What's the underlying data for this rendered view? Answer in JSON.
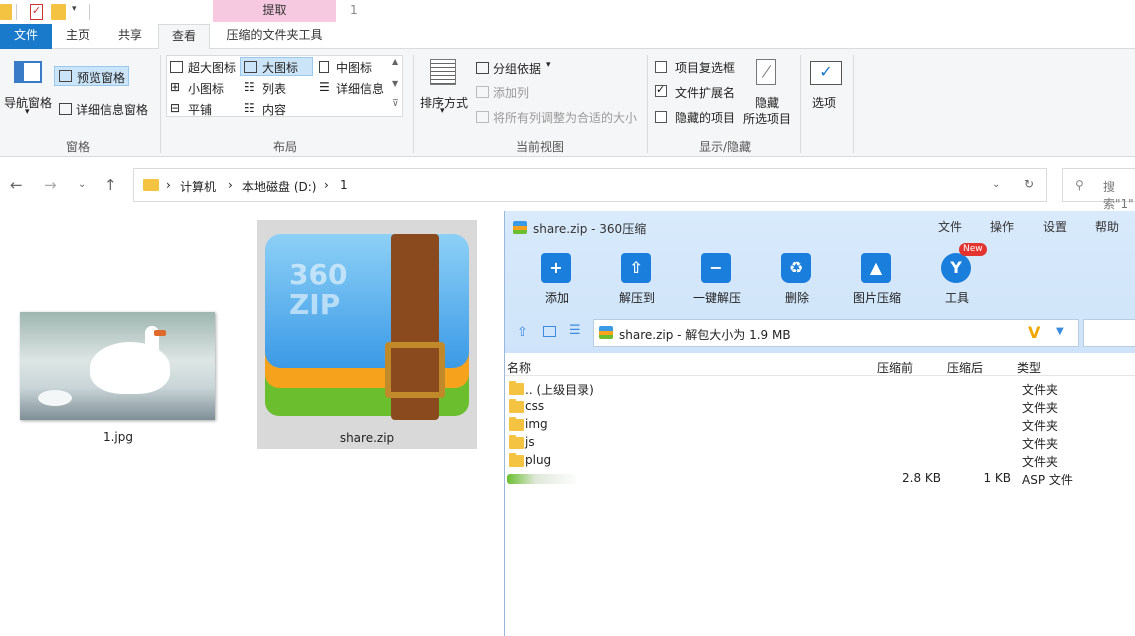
{
  "titlebar": {
    "context_header": "提取",
    "title": "1"
  },
  "ribbon_tabs": {
    "file": "文件",
    "home": "主页",
    "share": "共享",
    "view": "查看",
    "zip_tools": "压缩的文件夹工具"
  },
  "ribbon": {
    "panes": {
      "nav_pane": "导航窗格",
      "preview_pane": "预览窗格",
      "details_pane": "详细信息窗格",
      "label": "窗格"
    },
    "layout": {
      "extra_large": "超大图标",
      "large": "大图标",
      "medium": "中图标",
      "small": "小图标",
      "list": "列表",
      "details": "详细信息",
      "tiles": "平铺",
      "content": "内容",
      "label": "布局"
    },
    "current_view": {
      "sort_by": "排序方式",
      "group_by": "分组依据",
      "add_column": "添加列",
      "fit_columns": "将所有列调整为合适的大小",
      "label": "当前视图"
    },
    "show_hide": {
      "item_checkbox": "项目复选框",
      "extensions": "文件扩展名",
      "hidden_items": "隐藏的项目",
      "hide_selected_1": "隐藏",
      "hide_selected_2": "所选项目",
      "label": "显示/隐藏",
      "item_checkbox_checked": false,
      "extensions_checked": true,
      "hidden_items_checked": false
    },
    "options": "选项"
  },
  "address": {
    "crumbs": [
      "计算机",
      "本地磁盘 (D:)",
      "1"
    ],
    "search_placeholder": "搜索\"1\""
  },
  "files": [
    {
      "name": "1.jpg",
      "selected": false
    },
    {
      "name": "share.zip",
      "selected": true
    }
  ],
  "zip_window": {
    "title": "share.zip - 360压缩",
    "menu": [
      "文件",
      "操作",
      "设置",
      "帮助"
    ],
    "tools": [
      {
        "label": "添加",
        "icon": "add-icon"
      },
      {
        "label": "解压到",
        "icon": "extract-to-icon"
      },
      {
        "label": "一键解压",
        "icon": "one-click-extract-icon"
      },
      {
        "label": "删除",
        "icon": "delete-icon"
      },
      {
        "label": "图片压缩",
        "icon": "image-compress-icon"
      },
      {
        "label": "工具",
        "icon": "tools-icon",
        "badge": "New"
      }
    ],
    "path": "share.zip - 解包大小为 1.9 MB",
    "columns": {
      "name": "名称",
      "before": "压缩前",
      "after": "压缩后",
      "type": "类型"
    },
    "rows": [
      {
        "name": ".. (上级目录)",
        "before": "",
        "after": "",
        "type": "文件夹"
      },
      {
        "name": "css",
        "before": "",
        "after": "",
        "type": "文件夹"
      },
      {
        "name": "img",
        "before": "",
        "after": "",
        "type": "文件夹"
      },
      {
        "name": "js",
        "before": "",
        "after": "",
        "type": "文件夹"
      },
      {
        "name": "plug",
        "before": "",
        "after": "",
        "type": "文件夹"
      },
      {
        "name": "",
        "before": "2.8 KB",
        "after": "1 KB",
        "type": "ASP 文件"
      }
    ]
  },
  "colors": {
    "file_tab": "#1979ca",
    "context_tab": "#f6c9e0",
    "zip_header": "#d8eafb",
    "tool_blue": "#1a7fdc"
  }
}
